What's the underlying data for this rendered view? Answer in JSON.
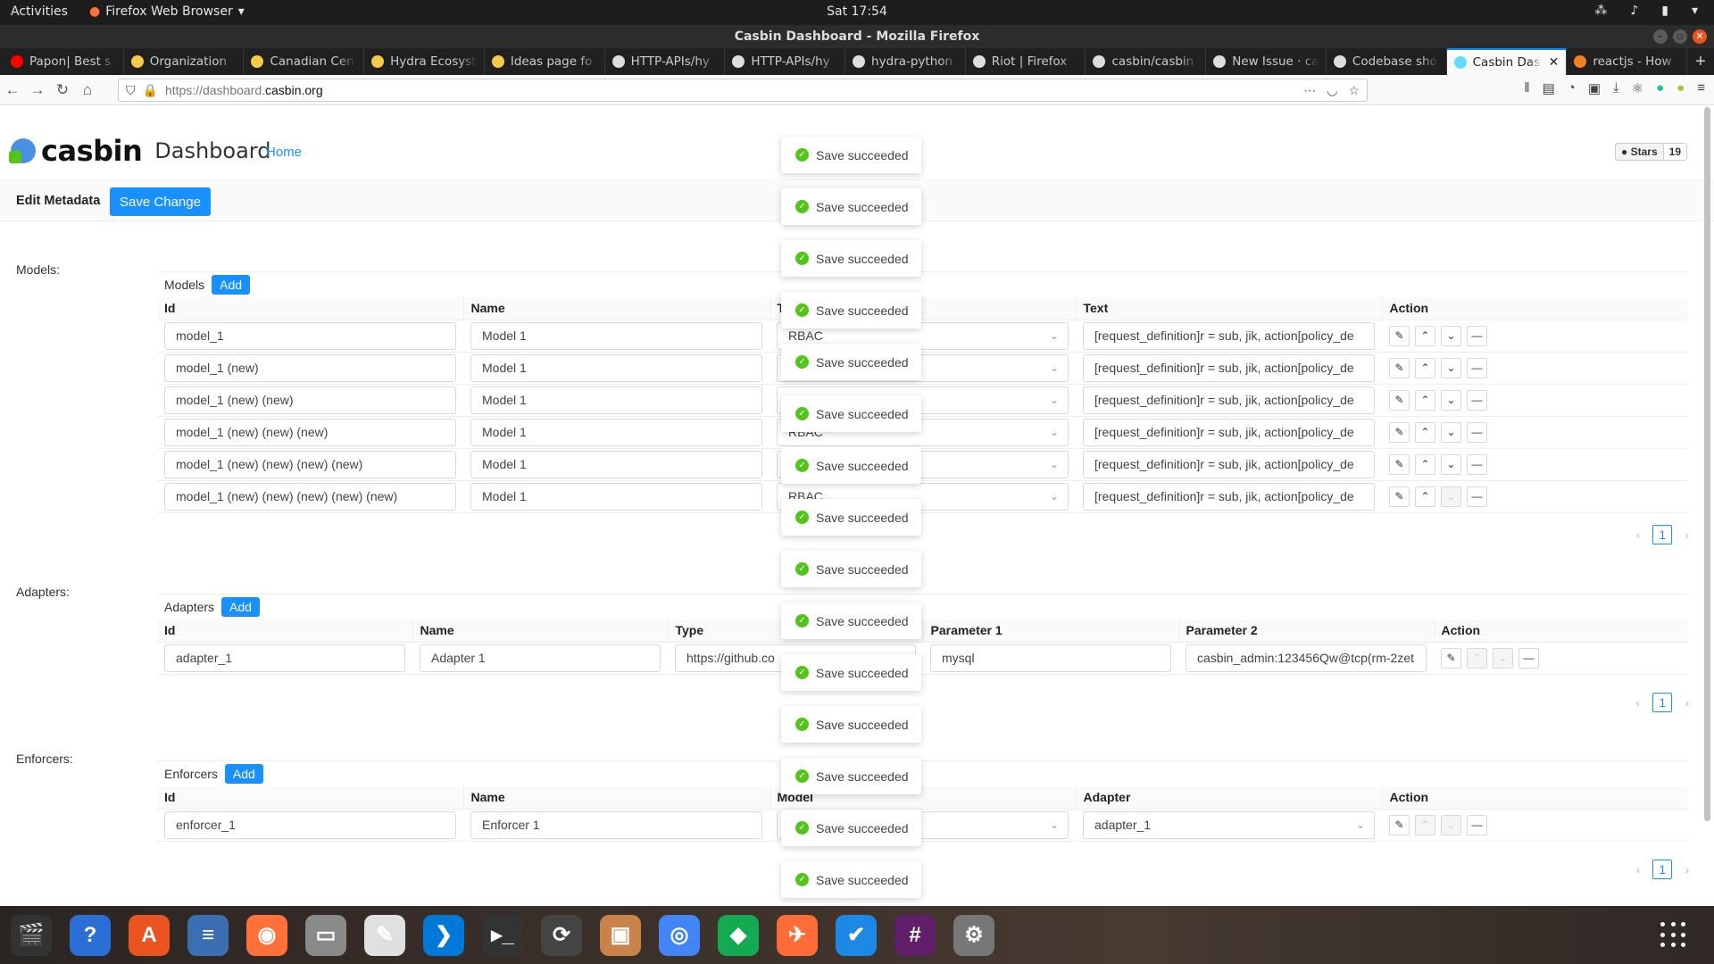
{
  "topbar": {
    "activities": "Activities",
    "app_menu": "Firefox Web Browser",
    "clock": "Sat 17:54"
  },
  "window": {
    "title": "Casbin Dashboard - Mozilla Firefox"
  },
  "tabs": [
    {
      "title": "Papon| Best s",
      "color": "#ff0000"
    },
    {
      "title": "Organization",
      "color": "#f7c948"
    },
    {
      "title": "Canadian Cen",
      "color": "#f7c948"
    },
    {
      "title": "Hydra Ecosyst",
      "color": "#f7c948"
    },
    {
      "title": "Ideas page fo",
      "color": "#f7c948"
    },
    {
      "title": "HTTP-APIs/hy",
      "color": "#dddddd"
    },
    {
      "title": "HTTP-APIs/hy",
      "color": "#dddddd"
    },
    {
      "title": "hydra-python",
      "color": "#dddddd"
    },
    {
      "title": "Riot | Firefox",
      "color": "#dddddd"
    },
    {
      "title": "casbin/casbin",
      "color": "#dddddd"
    },
    {
      "title": "New Issue · ca",
      "color": "#dddddd"
    },
    {
      "title": "Codebase sho",
      "color": "#dddddd"
    },
    {
      "title": "Casbin Das",
      "color": "#61dafb",
      "active": true
    },
    {
      "title": "reactjs - How",
      "color": "#f48024"
    }
  ],
  "url": {
    "prefix": "https://dashboard.",
    "host": "casbin.org"
  },
  "app": {
    "logo": "casbin",
    "dashboard": "Dashboard",
    "home": "Home",
    "stars_label": "Stars",
    "stars_count": "19",
    "edit_metadata": "Edit Metadata",
    "save_change": "Save Change"
  },
  "models": {
    "section": "Models:",
    "title": "Models",
    "add": "Add",
    "headers": [
      "Id",
      "Name",
      "T",
      "Text",
      "Action"
    ],
    "rows": [
      {
        "id": "model_1",
        "name": "Model 1",
        "type": "RBAC",
        "text": "[request_definition]r = sub, jik, action[policy_de"
      },
      {
        "id": "model_1 (new)",
        "name": "Model 1",
        "type": "",
        "text": "[request_definition]r = sub, jik, action[policy_de"
      },
      {
        "id": "model_1 (new) (new)",
        "name": "Model 1",
        "type": "",
        "text": "[request_definition]r = sub, jik, action[policy_de"
      },
      {
        "id": "model_1 (new) (new) (new)",
        "name": "Model 1",
        "type": "RBAC",
        "text": "[request_definition]r = sub, jik, action[policy_de"
      },
      {
        "id": "model_1 (new) (new) (new) (new)",
        "name": "Model 1",
        "type": "",
        "text": "[request_definition]r = sub, jik, action[policy_de"
      },
      {
        "id": "model_1 (new) (new) (new) (new) (new)",
        "name": "Model 1",
        "type": "RBAC",
        "text": "[request_definition]r = sub, jik, action[policy_de"
      }
    ],
    "page": "1"
  },
  "adapters": {
    "section": "Adapters:",
    "title": "Adapters",
    "add": "Add",
    "headers": [
      "Id",
      "Name",
      "Type",
      "Parameter 1",
      "Parameter 2",
      "Action"
    ],
    "rows": [
      {
        "id": "adapter_1",
        "name": "Adapter 1",
        "type": "https://github.co",
        "p1": "mysql",
        "p2": "casbin_admin:123456Qw@tcp(rm-2zet"
      }
    ],
    "page": "1"
  },
  "enforcers": {
    "section": "Enforcers:",
    "title": "Enforcers",
    "add": "Add",
    "headers": [
      "Id",
      "Name",
      "Model",
      "Adapter",
      "Action"
    ],
    "rows": [
      {
        "id": "enforcer_1",
        "name": "Enforcer 1",
        "model": "",
        "adapter": "adapter_1"
      }
    ],
    "page": "1"
  },
  "toast_message": "Save succeeded",
  "toasts": [
    "Save succeeded",
    "Save succeeded",
    "Save succeeded",
    "Save succeeded",
    "Save succeeded",
    "Save succeeded",
    "Save succeeded",
    "Save succeeded",
    "Save succeeded",
    "Save succeeded",
    "Save succeeded",
    "Save succeeded",
    "Save succeeded",
    "Save succeeded",
    "Save succeeded",
    "Save succeeded"
  ],
  "dock": [
    {
      "name": "clapper-icon",
      "glyph": "🎬",
      "color": "#333333"
    },
    {
      "name": "help-icon",
      "glyph": "?",
      "color": "#2a6fd6"
    },
    {
      "name": "software-center-icon",
      "glyph": "A",
      "color": "#e95420"
    },
    {
      "name": "text-editor-icon",
      "glyph": "≡",
      "color": "#3c6eb4"
    },
    {
      "name": "firefox-icon",
      "glyph": "◉",
      "color": "#ff7139"
    },
    {
      "name": "files-icon",
      "glyph": "▭",
      "color": "#8a8a8a"
    },
    {
      "name": "document-viewer-icon",
      "glyph": "✎",
      "color": "#e0e0e0"
    },
    {
      "name": "vscode-icon",
      "glyph": "❯",
      "color": "#0078d7"
    },
    {
      "name": "terminal-icon",
      "glyph": "▸_",
      "color": "#333333"
    },
    {
      "name": "updater-icon",
      "glyph": "⟳",
      "color": "#444444"
    },
    {
      "name": "archive-icon",
      "glyph": "▣",
      "color": "#c9824a"
    },
    {
      "name": "chrome-icon",
      "glyph": "◎",
      "color": "#4285f4"
    },
    {
      "name": "mongodb-icon",
      "glyph": "◆",
      "color": "#13aa52"
    },
    {
      "name": "postman-icon",
      "glyph": "✈",
      "color": "#ff6c37"
    },
    {
      "name": "tasks-icon",
      "glyph": "✔",
      "color": "#1e88e5"
    },
    {
      "name": "slack-icon",
      "glyph": "#",
      "color": "#611f69"
    },
    {
      "name": "settings-icon",
      "glyph": "⚙",
      "color": "#777777"
    }
  ]
}
